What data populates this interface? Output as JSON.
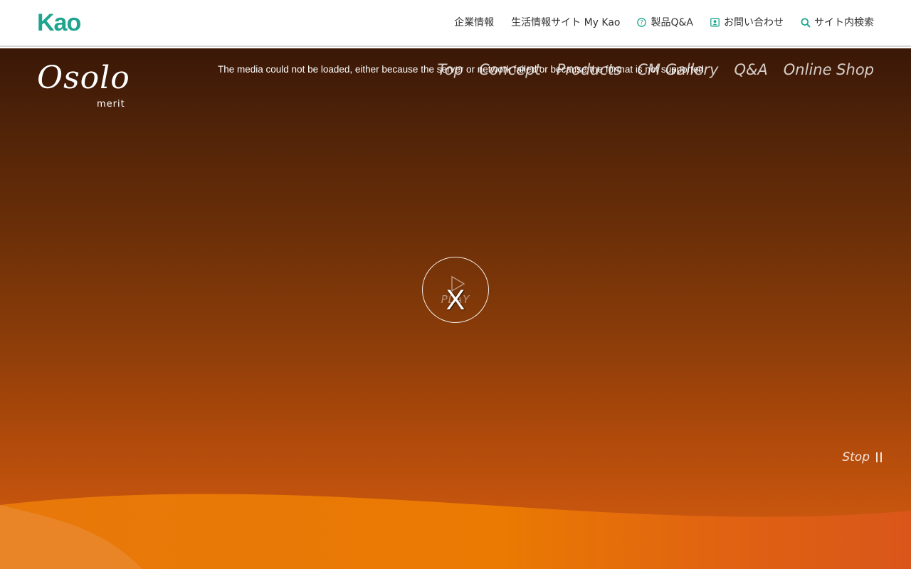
{
  "kao_header": {
    "logo_text": "Kao",
    "nav": [
      {
        "label": "企業情報",
        "icon": null
      },
      {
        "label": "生活情報サイト My Kao",
        "icon": null
      },
      {
        "label": "製品Q&A",
        "icon": "question-circle-icon"
      },
      {
        "label": "お問い合わせ",
        "icon": "contact-card-icon"
      },
      {
        "label": "サイト内検索",
        "icon": "search-icon"
      }
    ],
    "accent_color": "#1fa58f"
  },
  "brand": {
    "script": "Osolo",
    "sub": "merit"
  },
  "site_nav": [
    "Top",
    "Concept",
    "Products",
    "CM Gallery",
    "Q&A",
    "Online Shop"
  ],
  "media_error": "The media could not be loaded, either because the server or network failed or because the format is not supported.",
  "play": {
    "label": "PLAY",
    "close": "X"
  },
  "stop": {
    "label": "Stop"
  },
  "colors": {
    "hero_top": "#3a1707",
    "hero_bottom": "#d35c10",
    "wave": "#e87a05"
  }
}
